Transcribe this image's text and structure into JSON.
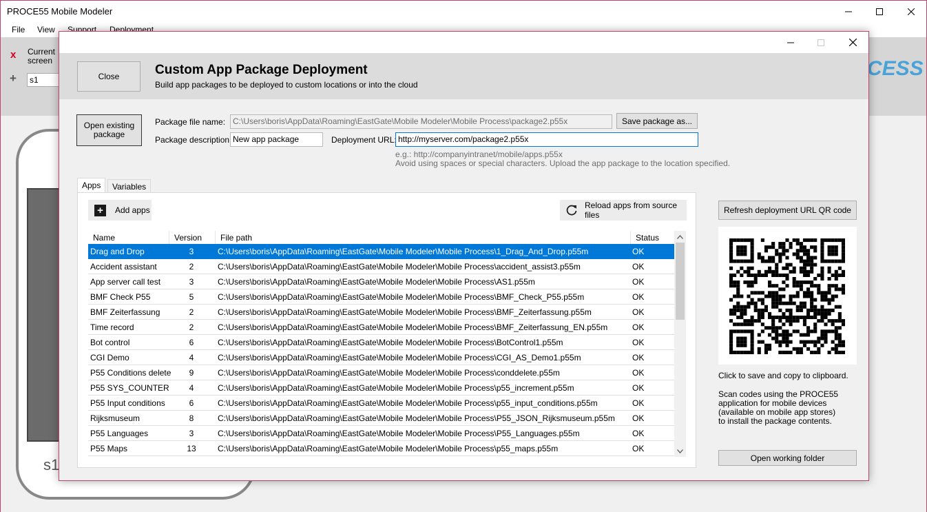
{
  "main_window": {
    "title": "PROCE55 Mobile Modeler",
    "menu": [
      "File",
      "View",
      "Support",
      "Deployment"
    ],
    "toolbar": {
      "close_x": "x",
      "current_screen_label": "Current screen",
      "add": "+",
      "screen_select_value": "s1"
    },
    "logo_text": "CESS",
    "phone_label": "s1"
  },
  "dialog": {
    "close_button": "Close",
    "title": "Custom App Package Deployment",
    "subtitle": "Build app packages to be deployed to custom locations or into the cloud",
    "open_existing_button": "Open existing package",
    "package_file_name_label": "Package file name:",
    "package_file_name_value": "C:\\Users\\boris\\AppData\\Roaming\\EastGate\\Mobile Modeler\\Mobile Process\\package2.p55x",
    "save_as_button": "Save package as...",
    "package_description_label": "Package description:",
    "package_description_value": "New app package",
    "deployment_url_label": "Deployment URL:",
    "deployment_url_value": "http://myserver.com/package2.p55x",
    "hint_example": "e.g.: http://companyintranet/mobile/apps.p55x",
    "hint_warning": "Avoid using spaces or special characters. Upload the app package to the location specified.",
    "tabs": [
      "Apps",
      "Variables"
    ],
    "add_apps_button": "Add apps",
    "reload_button": "Reload apps from source files",
    "columns": {
      "name": "Name",
      "version": "Version",
      "path": "File path",
      "status": "Status"
    },
    "apps": [
      {
        "name": "Drag and Drop",
        "version": "3",
        "path": "C:\\Users\\boris\\AppData\\Roaming\\EastGate\\Mobile Modeler\\Mobile Process\\1_Drag_And_Drop.p55m",
        "status": "OK",
        "selected": true
      },
      {
        "name": "Accident assistant",
        "version": "2",
        "path": "C:\\Users\\boris\\AppData\\Roaming\\EastGate\\Mobile Modeler\\Mobile Process\\accident_assist3.p55m",
        "status": "OK"
      },
      {
        "name": "App server call test",
        "version": "3",
        "path": "C:\\Users\\boris\\AppData\\Roaming\\EastGate\\Mobile Modeler\\Mobile Process\\AS1.p55m",
        "status": "OK"
      },
      {
        "name": "BMF Check P55",
        "version": "5",
        "path": "C:\\Users\\boris\\AppData\\Roaming\\EastGate\\Mobile Modeler\\Mobile Process\\BMF_Check_P55.p55m",
        "status": "OK"
      },
      {
        "name": "BMF Zeiterfassung",
        "version": "2",
        "path": "C:\\Users\\boris\\AppData\\Roaming\\EastGate\\Mobile Modeler\\Mobile Process\\BMF_Zeiterfassung.p55m",
        "status": "OK"
      },
      {
        "name": "Time record",
        "version": "2",
        "path": "C:\\Users\\boris\\AppData\\Roaming\\EastGate\\Mobile Modeler\\Mobile Process\\BMF_Zeiterfassung_EN.p55m",
        "status": "OK"
      },
      {
        "name": "Bot control",
        "version": "6",
        "path": "C:\\Users\\boris\\AppData\\Roaming\\EastGate\\Mobile Modeler\\Mobile Process\\BotControl1.p55m",
        "status": "OK"
      },
      {
        "name": "CGI Demo",
        "version": "4",
        "path": "C:\\Users\\boris\\AppData\\Roaming\\EastGate\\Mobile Modeler\\Mobile Process\\CGI_AS_Demo1.p55m",
        "status": "OK"
      },
      {
        "name": "P55 Conditions delete",
        "version": "9",
        "path": "C:\\Users\\boris\\AppData\\Roaming\\EastGate\\Mobile Modeler\\Mobile Process\\conddelete.p55m",
        "status": "OK"
      },
      {
        "name": "P55 SYS_COUNTER",
        "version": "4",
        "path": "C:\\Users\\boris\\AppData\\Roaming\\EastGate\\Mobile Modeler\\Mobile Process\\p55_increment.p55m",
        "status": "OK"
      },
      {
        "name": "P55 Input conditions",
        "version": "6",
        "path": "C:\\Users\\boris\\AppData\\Roaming\\EastGate\\Mobile Modeler\\Mobile Process\\p55_input_conditions.p55m",
        "status": "OK"
      },
      {
        "name": "Rijksmuseum",
        "version": "8",
        "path": "C:\\Users\\boris\\AppData\\Roaming\\EastGate\\Mobile Modeler\\Mobile Process\\P55_JSON_Rijksmuseum.p55m",
        "status": "OK"
      },
      {
        "name": "P55 Languages",
        "version": "3",
        "path": "C:\\Users\\boris\\AppData\\Roaming\\EastGate\\Mobile Modeler\\Mobile Process\\P55_Languages.p55m",
        "status": "OK"
      },
      {
        "name": "P55 Maps",
        "version": "13",
        "path": "C:\\Users\\boris\\AppData\\Roaming\\EastGate\\Mobile Modeler\\Mobile Process\\p55_maps.p55m",
        "status": "OK"
      }
    ],
    "refresh_qr_button": "Refresh deployment URL QR code",
    "click_to_save_text": "Click to save and copy to clipboard.",
    "scan_text": [
      "Scan codes using the PROCE55",
      "application for mobile devices",
      "(available on mobile app stores)",
      "to install the package contents."
    ],
    "open_folder_button": "Open working folder",
    "colors": {
      "selection": "#0078d7",
      "header_band": "#dcdcdc",
      "window_border": "#c0436c"
    }
  }
}
